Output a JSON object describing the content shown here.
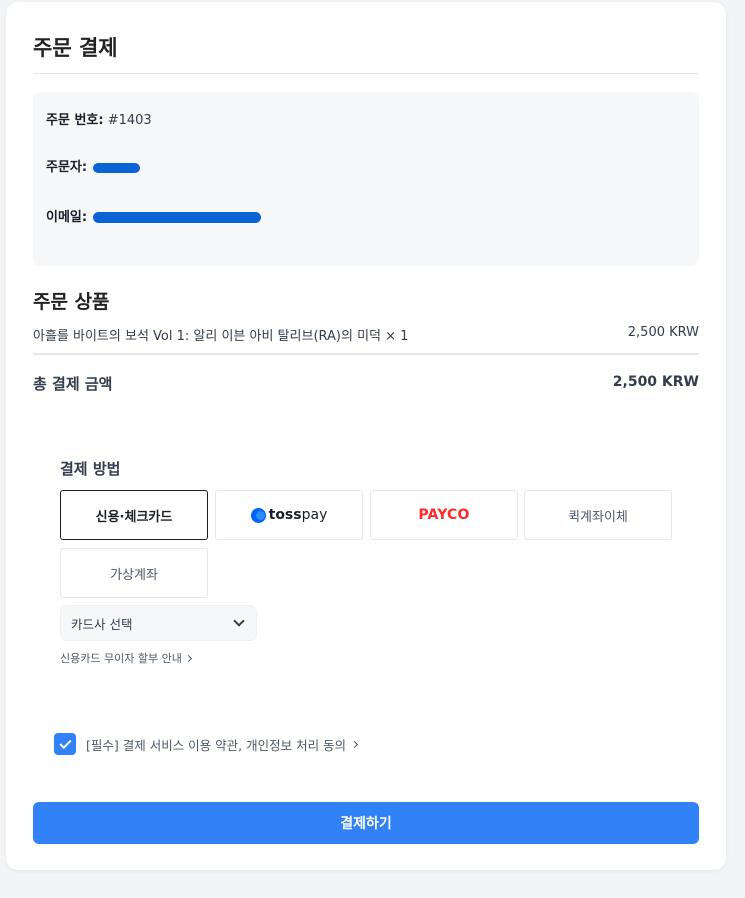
{
  "page": {
    "title": "주문 결제"
  },
  "order_info": {
    "order_number_label": "주문 번호:",
    "order_number_value": "#1403",
    "orderer_label": "주문자:",
    "email_label": "이메일:"
  },
  "products": {
    "section_title": "주문 상품",
    "items": [
      {
        "name": "아흘를 바이트의 보석 Vol 1: 알리 이븐 아비 탈리브(RA)의 미덕 × 1",
        "price": "2,500 KRW"
      }
    ]
  },
  "total": {
    "label": "총 결제 금액",
    "value": "2,500 KRW"
  },
  "payment": {
    "section_title": "결제 방법",
    "methods": [
      {
        "label": "신용·체크카드",
        "selected": true
      },
      {
        "label": "toss pay",
        "logo_part1": "toss",
        "logo_part2": "pay",
        "selected": false
      },
      {
        "label": "PAYCO",
        "selected": false
      },
      {
        "label": "퀵계좌이체",
        "selected": false
      },
      {
        "label": "가상계좌",
        "selected": false
      }
    ],
    "card_select": {
      "value": "카드사 선택"
    },
    "installment_link": "신용카드 무이자 할부 안내"
  },
  "agreement": {
    "text": "[필수] 결제 서비스 이용 약관, 개인정보 처리 동의",
    "checked": true
  },
  "submit": {
    "label": "결제하기"
  },
  "colors": {
    "accent": "#3182f6",
    "payco": "#ff2a2a",
    "toss": "#0064ff",
    "redaction": "#0b63d6"
  },
  "icons": [
    "chevron-down-icon",
    "chevron-right-icon",
    "check-icon",
    "toss-logo-icon"
  ]
}
